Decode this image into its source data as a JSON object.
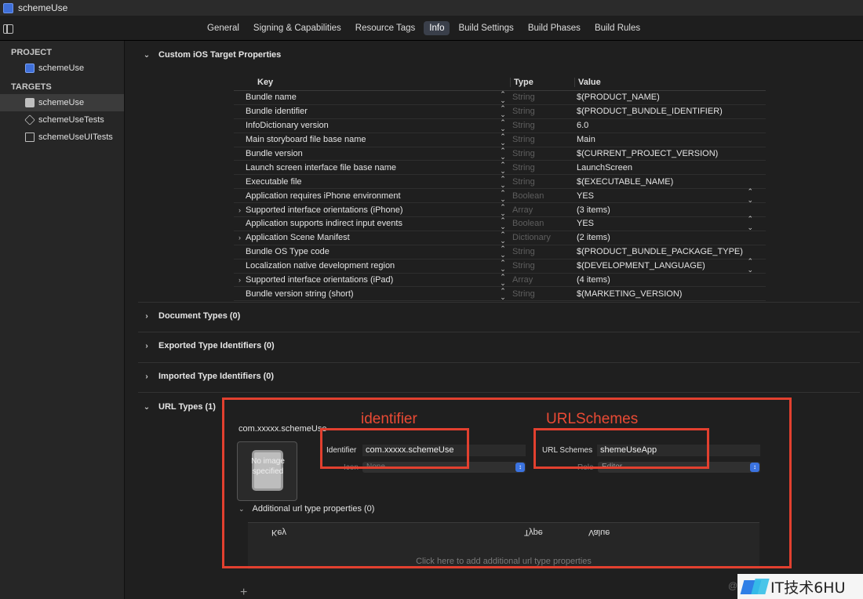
{
  "window": {
    "title": "schemeUse"
  },
  "tabs": [
    {
      "label": "General",
      "active": false
    },
    {
      "label": "Signing & Capabilities",
      "active": false
    },
    {
      "label": "Resource Tags",
      "active": false
    },
    {
      "label": "Info",
      "active": true
    },
    {
      "label": "Build Settings",
      "active": false
    },
    {
      "label": "Build Phases",
      "active": false
    },
    {
      "label": "Build Rules",
      "active": false
    }
  ],
  "sidebar": {
    "project_header": "PROJECT",
    "project_item": "schemeUse",
    "targets_header": "TARGETS",
    "targets": [
      {
        "label": "schemeUse",
        "icon": "app-icon",
        "selected": true
      },
      {
        "label": "schemeUseTests",
        "icon": "test-icon",
        "selected": false
      },
      {
        "label": "schemeUseUITests",
        "icon": "ui-test-icon",
        "selected": false
      }
    ]
  },
  "sections": {
    "custom_props": "Custom iOS Target Properties",
    "document_types": "Document Types (0)",
    "exported_types": "Exported Type Identifiers (0)",
    "imported_types": "Imported Type Identifiers (0)",
    "url_types": "URL Types (1)"
  },
  "plist": {
    "header": {
      "key": "Key",
      "type": "Type",
      "value": "Value"
    },
    "rows": [
      {
        "key": "Bundle name",
        "type": "String",
        "value": "$(PRODUCT_NAME)",
        "expandable": false,
        "value_stepper": false
      },
      {
        "key": "Bundle identifier",
        "type": "String",
        "value": "$(PRODUCT_BUNDLE_IDENTIFIER)",
        "expandable": false,
        "value_stepper": false
      },
      {
        "key": "InfoDictionary version",
        "type": "String",
        "value": "6.0",
        "expandable": false,
        "value_stepper": false
      },
      {
        "key": "Main storyboard file base name",
        "type": "String",
        "value": "Main",
        "expandable": false,
        "value_stepper": false
      },
      {
        "key": "Bundle version",
        "type": "String",
        "value": "$(CURRENT_PROJECT_VERSION)",
        "expandable": false,
        "value_stepper": false
      },
      {
        "key": "Launch screen interface file base name",
        "type": "String",
        "value": "LaunchScreen",
        "expandable": false,
        "value_stepper": false
      },
      {
        "key": "Executable file",
        "type": "String",
        "value": "$(EXECUTABLE_NAME)",
        "expandable": false,
        "value_stepper": false
      },
      {
        "key": "Application requires iPhone environment",
        "type": "Boolean",
        "value": "YES",
        "expandable": false,
        "value_stepper": true
      },
      {
        "key": "Supported interface orientations (iPhone)",
        "type": "Array",
        "value": "(3 items)",
        "expandable": true,
        "value_stepper": false
      },
      {
        "key": "Application supports indirect input events",
        "type": "Boolean",
        "value": "YES",
        "expandable": false,
        "value_stepper": true
      },
      {
        "key": "Application Scene Manifest",
        "type": "Dictionary",
        "value": "(2 items)",
        "expandable": true,
        "value_stepper": false
      },
      {
        "key": "Bundle OS Type code",
        "type": "String",
        "value": "$(PRODUCT_BUNDLE_PACKAGE_TYPE)",
        "expandable": false,
        "value_stepper": false
      },
      {
        "key": "Localization native development region",
        "type": "String",
        "value": "$(DEVELOPMENT_LANGUAGE)",
        "expandable": false,
        "value_stepper": true
      },
      {
        "key": "Supported interface orientations (iPad)",
        "type": "Array",
        "value": "(4 items)",
        "expandable": true,
        "value_stepper": false
      },
      {
        "key": "Bundle version string (short)",
        "type": "String",
        "value": "$(MARKETING_VERSION)",
        "expandable": false,
        "value_stepper": false
      }
    ]
  },
  "url_type": {
    "name": "com.xxxxx.schemeUse",
    "image_placeholder": "No image specified",
    "identifier_label": "Identifier",
    "identifier_value": "com.xxxxx.schemeUse",
    "icon_label": "Icon",
    "icon_placeholder": "None",
    "url_schemes_label": "URL Schemes",
    "url_schemes_value": "shemeUseApp",
    "role_label": "Role",
    "role_value": "Editor",
    "additional_props": "Additional url type properties (0)",
    "additional_headers": {
      "key": "Key",
      "type": "Type",
      "value": "Value"
    },
    "additional_hint": "Click here to add additional url type properties",
    "add_symbol": "+"
  },
  "annotations": {
    "identifier": "identifier",
    "url_schemes": "URLSchemes",
    "color": "#e2402f"
  },
  "watermark": {
    "text": "IT技术6HU",
    "at": "@"
  }
}
